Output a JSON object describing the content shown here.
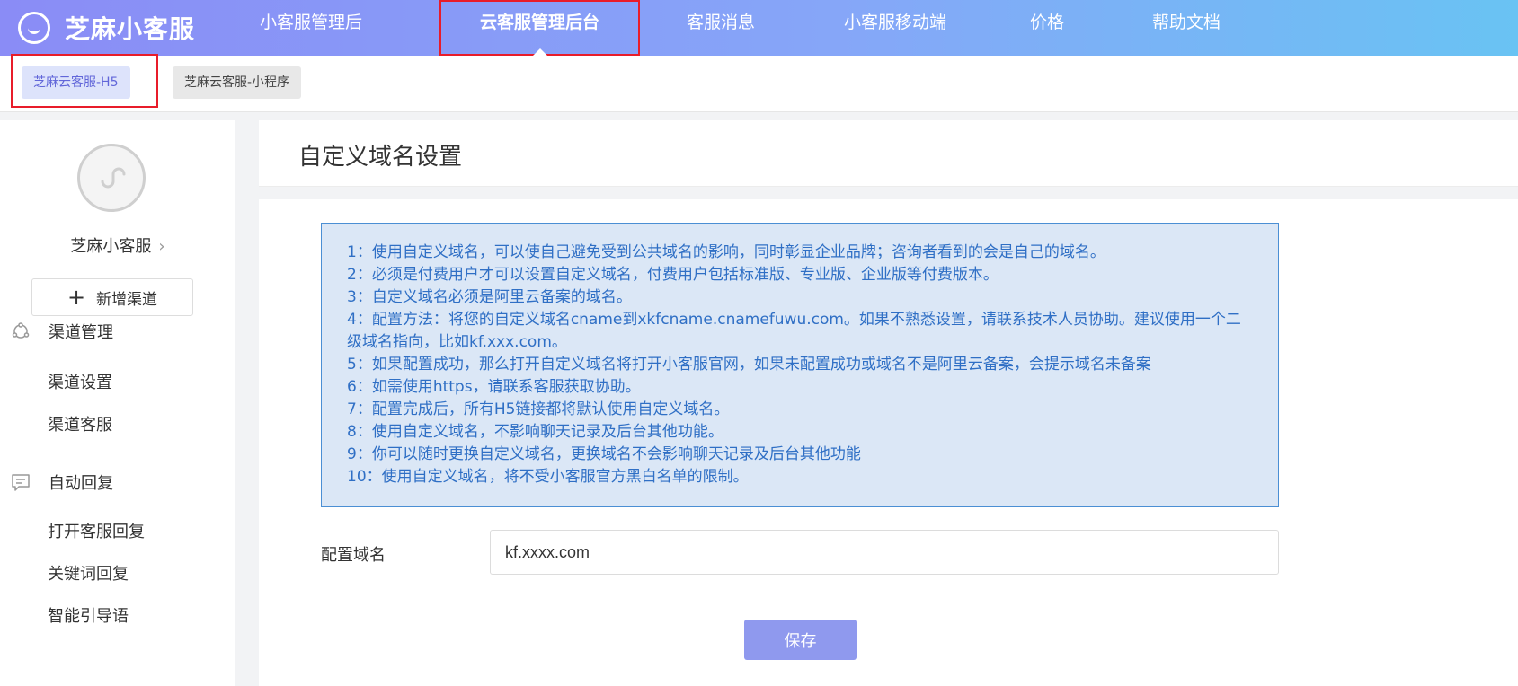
{
  "brand": {
    "name": "芝麻小客服"
  },
  "nav": {
    "items": [
      {
        "label": "小客服管理后台"
      },
      {
        "label": "云客服管理后台"
      },
      {
        "label": "客服消息"
      },
      {
        "label": "小客服移动端"
      },
      {
        "label": "价格"
      },
      {
        "label": "帮助文档"
      }
    ],
    "active_index": 1
  },
  "subtabs": [
    {
      "label": "芝麻云客服-H5"
    },
    {
      "label": "芝麻云客服-小程序"
    }
  ],
  "sidebar": {
    "shop_name": "芝麻小客服",
    "add_channel_label": "新增渠道",
    "sections": [
      {
        "label": "渠道管理",
        "icon": "channel-icon",
        "items": [
          "渠道设置",
          "渠道客服"
        ]
      },
      {
        "label": "自动回复",
        "icon": "message-icon",
        "items": [
          "打开客服回复",
          "关键词回复",
          "智能引导语"
        ]
      }
    ]
  },
  "main": {
    "title": "自定义域名设置",
    "notice_lines": [
      "1：使用自定义域名，可以使自己避免受到公共域名的影响，同时彰显企业品牌；咨询者看到的会是自己的域名。",
      "2：必须是付费用户才可以设置自定义域名，付费用户包括标准版、专业版、企业版等付费版本。",
      "3：自定义域名必须是阿里云备案的域名。",
      "4：配置方法：将您的自定义域名cname到xkfcname.cnamefuwu.com。如果不熟悉设置，请联系技术人员协助。建议使用一个二级域名指向，比如kf.xxx.com。",
      "5：如果配置成功，那么打开自定义域名将打开小客服官网，如果未配置成功或域名不是阿里云备案，会提示域名未备案",
      "6：如需使用https，请联系客服获取协助。",
      "7：配置完成后，所有H5链接都将默认使用自定义域名。",
      "8：使用自定义域名，不影响聊天记录及后台其他功能。",
      "9：你可以随时更换自定义域名，更换域名不会影响聊天记录及后台其他功能",
      "10：使用自定义域名，将不受小客服官方黑白名单的限制。"
    ],
    "domain_label": "配置域名",
    "domain_value": "kf.xxxx.com",
    "save_label": "保存"
  },
  "colors": {
    "accent": "#8a8cf6",
    "highlight": "#e81c2a",
    "notice_text": "#2f6fc5"
  }
}
